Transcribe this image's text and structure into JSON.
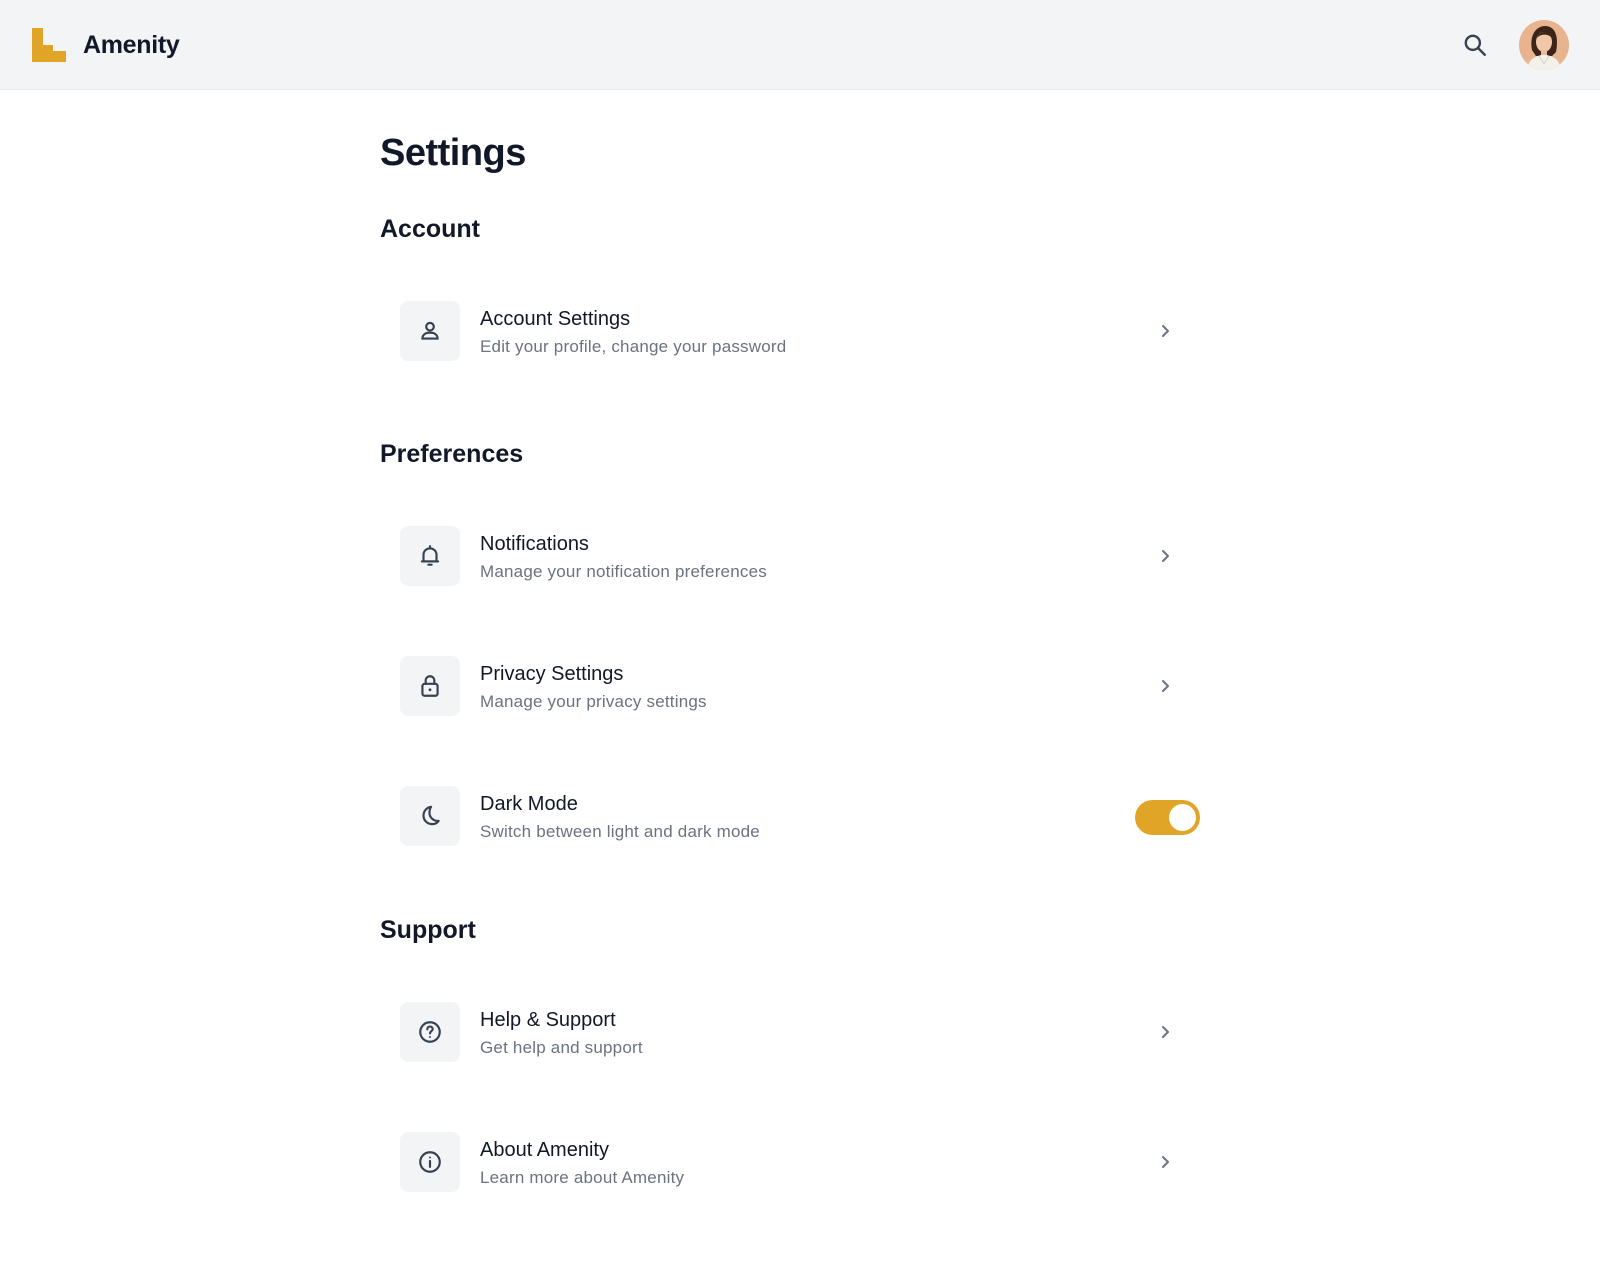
{
  "header": {
    "app_name": "Amenity",
    "brand_color": "#e0a526",
    "search_icon": "search-icon",
    "avatar": "user-avatar"
  },
  "page": {
    "title": "Settings"
  },
  "sections": {
    "account": {
      "title": "Account",
      "items": [
        {
          "icon": "user-icon",
          "title": "Account Settings",
          "subtitle": "Edit your profile, change your password",
          "control": "chevron"
        }
      ]
    },
    "preferences": {
      "title": "Preferences",
      "items": [
        {
          "icon": "bell-icon",
          "title": "Notifications",
          "subtitle": "Manage your notification preferences",
          "control": "chevron"
        },
        {
          "icon": "lock-icon",
          "title": "Privacy Settings",
          "subtitle": "Manage your privacy settings",
          "control": "chevron"
        },
        {
          "icon": "moon-icon",
          "title": "Dark Mode",
          "subtitle": "Switch between light and dark mode",
          "control": "toggle",
          "toggle_on": true
        }
      ]
    },
    "support": {
      "title": "Support",
      "items": [
        {
          "icon": "help-circle-icon",
          "title": "Help & Support",
          "subtitle": "Get help and support",
          "control": "chevron"
        },
        {
          "icon": "info-icon",
          "title": "About Amenity",
          "subtitle": "Learn more about Amenity",
          "control": "chevron"
        }
      ]
    }
  },
  "colors": {
    "accent": "#e0a526",
    "header_bg": "#f3f4f6",
    "icon_box_bg": "#f3f4f6",
    "text_primary": "#111827",
    "text_secondary": "#6b7280"
  }
}
